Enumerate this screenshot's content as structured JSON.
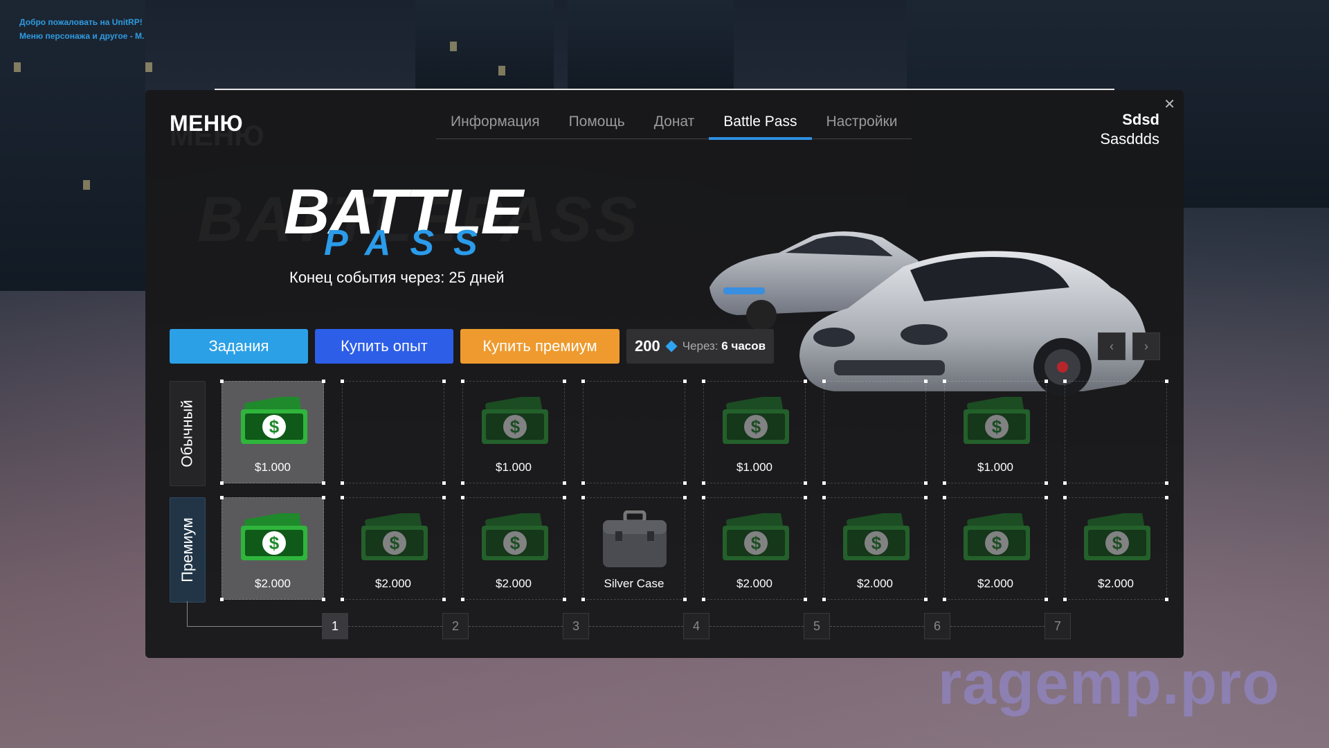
{
  "hud": {
    "line1": "Добро пожаловать на UnitRP!",
    "line2": "Меню персонажа и другое - M."
  },
  "watermark": "ragemp.pro",
  "menu": {
    "title": "МЕНЮ",
    "title_ghost": "МЕНЮ",
    "close_icon": "close-icon",
    "tabs": [
      {
        "label": "Информация",
        "active": false
      },
      {
        "label": "Помощь",
        "active": false
      },
      {
        "label": "Донат",
        "active": false
      },
      {
        "label": "Battle Pass",
        "active": true
      },
      {
        "label": "Настройки",
        "active": false
      }
    ],
    "user": {
      "name": "Sdsd",
      "surname": "Sasddds"
    }
  },
  "battlepass": {
    "ghost": "BATTLEPASS",
    "title_top": "BATTLE",
    "title_bottom": "PASS",
    "ends_text": "Конец события через: 25 дней",
    "accent_color": "#2b9bea"
  },
  "actions": {
    "tasks": "Задания",
    "buy_exp": "Купить опыт",
    "buy_premium": "Купить премиум",
    "points": "200",
    "timer_label": "Через:",
    "timer_value": "6 часов"
  },
  "rows": {
    "normal_label": "Обычный",
    "premium_label": "Премиум"
  },
  "normal_rewards": [
    {
      "label": "$1.000",
      "icon": "money-icon",
      "active": true
    },
    {
      "label": "",
      "icon": "",
      "active": false
    },
    {
      "label": "$1.000",
      "icon": "money-icon",
      "active": false
    },
    {
      "label": "",
      "icon": "",
      "active": false
    },
    {
      "label": "$1.000",
      "icon": "money-icon",
      "active": false
    },
    {
      "label": "",
      "icon": "",
      "active": false
    },
    {
      "label": "$1.000",
      "icon": "money-icon",
      "active": false
    },
    {
      "label": "",
      "icon": "",
      "active": false
    }
  ],
  "premium_rewards": [
    {
      "label": "$2.000",
      "icon": "money-icon",
      "active": true
    },
    {
      "label": "$2.000",
      "icon": "money-icon",
      "active": false
    },
    {
      "label": "$2.000",
      "icon": "money-icon",
      "active": false
    },
    {
      "label": "Silver Case",
      "icon": "case-icon",
      "active": false
    },
    {
      "label": "$2.000",
      "icon": "money-icon",
      "active": false
    },
    {
      "label": "$2.000",
      "icon": "money-icon",
      "active": false
    },
    {
      "label": "$2.000",
      "icon": "money-icon",
      "active": false
    },
    {
      "label": "$2.000",
      "icon": "money-icon",
      "active": false
    }
  ],
  "levels": [
    "1",
    "2",
    "3",
    "4",
    "5",
    "6",
    "7"
  ]
}
